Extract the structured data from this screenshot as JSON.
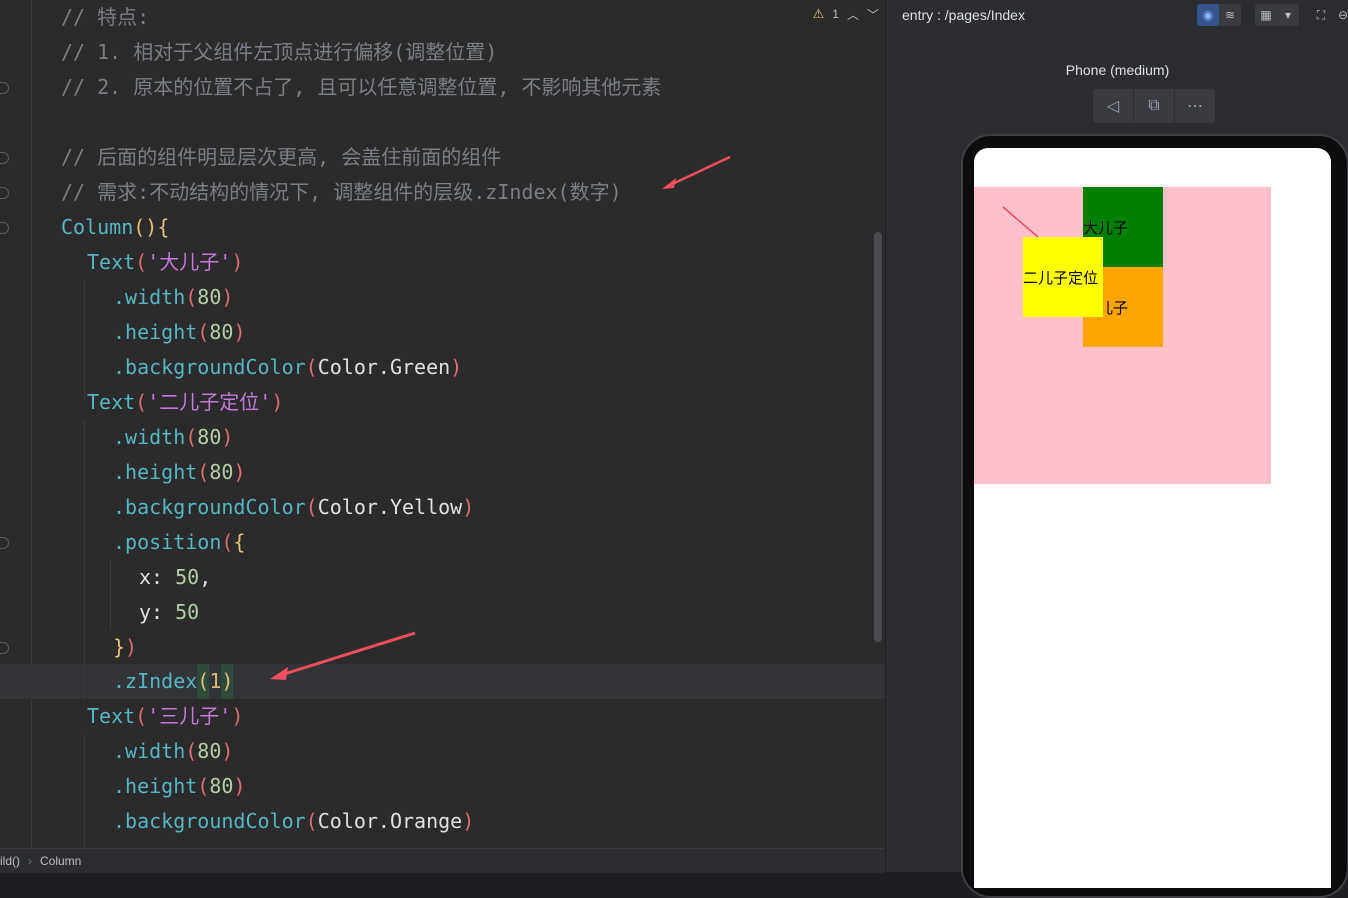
{
  "editor": {
    "warnings": "1",
    "lines": [
      {
        "cmt": "// 特点:"
      },
      {
        "cmt": "// 1. 相对于父组件左顶点进行偏移(调整位置)"
      },
      {
        "cmt": "// 2. 原本的位置不占了, 且可以任意调整位置, 不影响其他元素"
      },
      {
        "cmt": ""
      },
      {
        "cmt": "// 后面的组件明显层次更高, 会盖住前面的组件"
      },
      {
        "cmt": "// 需求:不动结构的情况下, 调整组件的层级.zIndex(数字)"
      }
    ],
    "code": {
      "column": "Column",
      "text": "Text",
      "t1": "'大儿子'",
      "t2": "'二儿子定位'",
      "t3": "'三儿子'",
      "width": ".width",
      "height": ".height",
      "bg": ".backgroundColor",
      "position": ".position",
      "zindex": ".zIndex",
      "n80": "80",
      "n50": "50",
      "n1": "1",
      "green": "Color.Green",
      "yellow": "Color.Yellow",
      "orange": "Color.Orange",
      "x": "x",
      "y": "y"
    }
  },
  "statusbar": {
    "crumb1": "ild()",
    "crumb2": "Column"
  },
  "preview": {
    "entry": "entry : /pages/Index",
    "device": "Phone (medium)",
    "boxes": {
      "big": "大儿子",
      "second": "二儿子定位",
      "third": "三儿子"
    },
    "colors": {
      "pink": "#ffc0cb",
      "green": "#008000",
      "yellow": "#ffff00",
      "orange": "#ffa500"
    }
  }
}
